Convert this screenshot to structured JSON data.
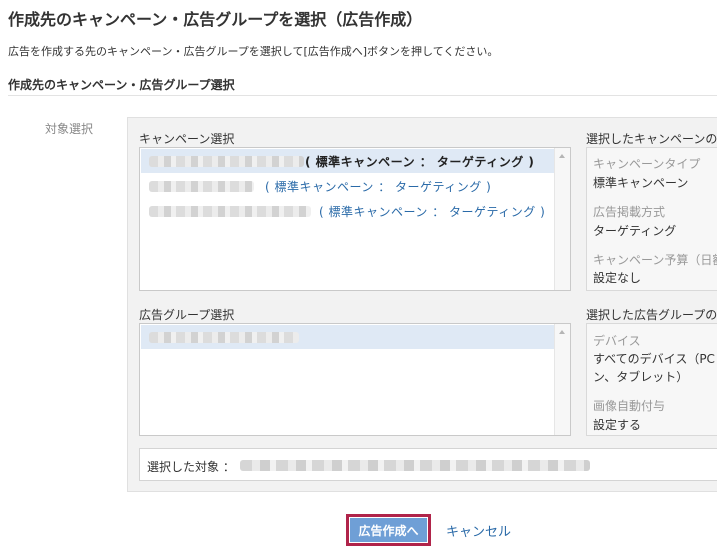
{
  "page": {
    "title": "作成先のキャンペーン・広告グループを選択（広告作成）",
    "description": "広告を作成する先のキャンペーン・広告グループを選択して[広告作成へ]ボタンを押してください。",
    "section_heading": "作成先のキャンペーン・広告グループ選択",
    "target_label": "対象選択"
  },
  "campaign_select": {
    "label": "キャンペーン選択",
    "items": [
      {
        "suffix": "( 標準キャンペーン ： ターゲティング )",
        "selected": true
      },
      {
        "suffix": "( 標準キャンペーン ： ターゲティング )",
        "selected": false
      },
      {
        "suffix": "( 標準キャンペーン ： ターゲティング )",
        "selected": false
      }
    ]
  },
  "campaign_details": {
    "header": "選択したキャンペーンの",
    "campaign_type_label": "キャンペーンタイプ",
    "campaign_type_value": "標準キャンペーン",
    "ad_delivery_label": "広告掲載方式",
    "ad_delivery_value": "ターゲティング",
    "budget_label": "キャンペーン予算（日額",
    "budget_value": "設定なし"
  },
  "adgroup_select": {
    "label": "広告グループ選択"
  },
  "adgroup_details": {
    "header": "選択した広告グループの",
    "device_label": "デバイス",
    "device_value_line1": "すべてのデバイス（PC",
    "device_value_line2": "ン、タブレット）",
    "image_auto_label": "画像自動付与",
    "image_auto_value": "設定する"
  },
  "selected_target": {
    "label": "選択した対象 ："
  },
  "actions": {
    "create_label": "広告作成へ",
    "cancel_label": "キャンセル"
  },
  "colors": {
    "primary_button": "#6f9fd6",
    "button_highlight_border": "#b0244a",
    "link": "#2a6aa8",
    "selected_row": "#dfe9f5"
  }
}
